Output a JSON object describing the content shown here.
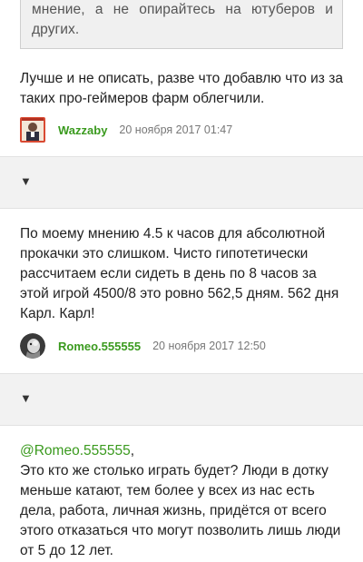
{
  "quote": {
    "text": "мнение, а не опирайтесь на ютуберов и других."
  },
  "comments": [
    {
      "text": "Лучше и не описать, разве что добавлю что из за таких про-геймеров фарм облегчили.",
      "author": "Wazzaby",
      "date": "20 ноября 2017 01:47"
    },
    {
      "text": "По моему мнению 4.5 к часов для абсолютной прокачки это слишком. Чисто гипотетически рассчитаем если сидеть в день по 8 часов за этой игрой 4500/8 это ровно 562,5 дням. 562 дня Карл. Карл!",
      "author": "Romeo.555555",
      "date": "20 ноября 2017 12:50"
    },
    {
      "mention": "@Romeo.555555",
      "mention_suffix": ",",
      "text": "Это кто же столько играть будет? Люди в дотку меньше катают, тем более у всех из нас есть дела, работа, личная жизнь, придётся от всего этого отказаться что могут позволить лишь люди от 5 до 12 лет."
    }
  ],
  "dividers": [
    {
      "toggle_icon": "▼"
    },
    {
      "toggle_icon": "▼"
    }
  ],
  "colors": {
    "author": "#3a9a1e",
    "divider_bg": "#f2f2f2",
    "quote_bg": "#f0f0f0"
  }
}
